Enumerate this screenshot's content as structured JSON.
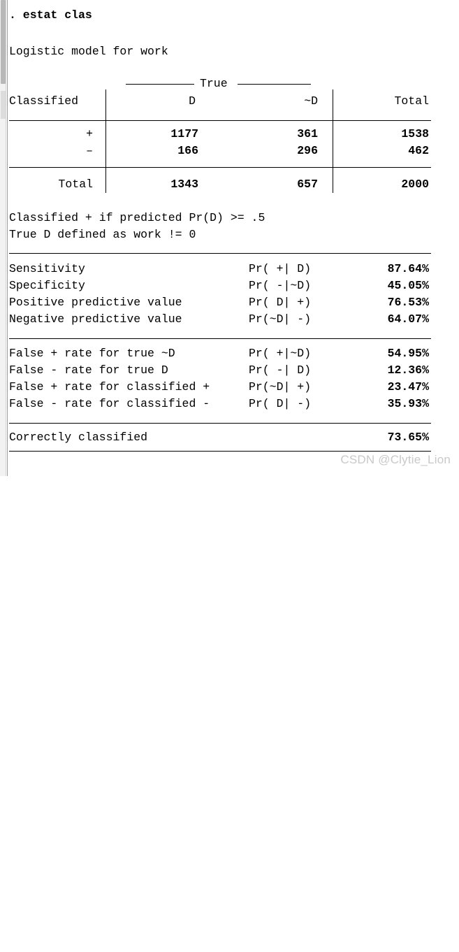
{
  "command": {
    "prompt": ".",
    "text": "estat clas",
    "full": ". estat clas"
  },
  "model_header": "Logistic model for work",
  "table": {
    "spanner_label": "True",
    "corner_label": "Classified",
    "column_headers": [
      "D",
      "~D",
      "Total"
    ],
    "rows": [
      {
        "label": "+",
        "values": [
          "1177",
          "361",
          "1538"
        ]
      },
      {
        "label": "–",
        "values": [
          "166",
          "296",
          "462"
        ]
      }
    ],
    "total_row": {
      "label": "Total",
      "values": [
        "1343",
        "657",
        "2000"
      ]
    }
  },
  "definitions": [
    "Classified + if predicted Pr(D) >= .5",
    "True D defined as work != 0"
  ],
  "statistics_block_1": [
    {
      "name": "Sensitivity",
      "formula": "Pr( +| D)",
      "value": "87.64%"
    },
    {
      "name": "Specificity",
      "formula": "Pr( -|~D)",
      "value": "45.05%"
    },
    {
      "name": "Positive predictive value",
      "formula": "Pr( D| +)",
      "value": "76.53%"
    },
    {
      "name": "Negative predictive value",
      "formula": "Pr(~D| -)",
      "value": "64.07%"
    }
  ],
  "statistics_block_2": [
    {
      "name": "False + rate for true ~D",
      "formula": "Pr( +|~D)",
      "value": "54.95%"
    },
    {
      "name": "False - rate for true D",
      "formula": "Pr( -| D)",
      "value": "12.36%"
    },
    {
      "name": "False + rate for classified +",
      "formula": "Pr(~D| +)",
      "value": "23.47%"
    },
    {
      "name": "False - rate for classified -",
      "formula": "Pr( D| -)",
      "value": "35.93%"
    }
  ],
  "summary": {
    "name": "Correctly classified",
    "value": "73.65%"
  },
  "watermark": "CSDN @Clytie_Lion",
  "colors": {
    "text": "#000000",
    "rule": "#000000",
    "watermark": "#c9c9c9",
    "scrollbar_track": "#f2f2f2",
    "scrollbar_thumb": "#b8b8b8",
    "panel_edge": "#9a9a9a",
    "background": "#ffffff"
  },
  "chart_data": {
    "type": "table",
    "title": "Logistic model for work — classification table",
    "row_label": "Classified",
    "col_label": "True",
    "categories": [
      "D",
      "~D",
      "Total"
    ],
    "series": [
      {
        "name": "+",
        "values": [
          1177,
          361,
          1538
        ]
      },
      {
        "name": "-",
        "values": [
          166,
          296,
          462
        ]
      },
      {
        "name": "Total",
        "values": [
          1343,
          657,
          2000
        ]
      }
    ],
    "metrics": {
      "sensitivity": 87.64,
      "specificity": 45.05,
      "positive_predictive_value": 76.53,
      "negative_predictive_value": 64.07,
      "false_positive_rate_true_notD": 54.95,
      "false_negative_rate_true_D": 12.36,
      "false_positive_rate_classified_plus": 23.47,
      "false_negative_rate_classified_minus": 35.93,
      "correctly_classified": 73.65
    },
    "cutoff": 0.5
  }
}
